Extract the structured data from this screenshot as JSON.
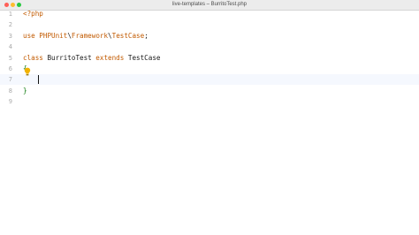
{
  "window": {
    "title": "live-templates – BurritoTest.php"
  },
  "gutter": {
    "line_numbers": [
      "1",
      "2",
      "3",
      "4",
      "5",
      "6",
      "7",
      "8",
      "9"
    ]
  },
  "code": {
    "line1_open_tag": "<?php",
    "line3_use": "use ",
    "line3_ns1": "PHPUnit",
    "line3_sep1": "\\",
    "line3_ns2": "Framework",
    "line3_sep2": "\\",
    "line3_cls": "TestCase",
    "line3_semi": ";",
    "line5_class": "class ",
    "line5_name": "BurritoTest",
    "line5_extends": " extends ",
    "line5_parent": "TestCase",
    "line6_open_brace": "{",
    "line8_close_brace": "}"
  },
  "icons": {
    "intention_bulb": "lightbulb-icon",
    "close": "close-window-icon",
    "minimize": "minimize-window-icon",
    "maximize": "maximize-window-icon"
  },
  "colors": {
    "keyword": "#c25a00",
    "brace": "#0e7a0e",
    "current_line": "#f5f8fe",
    "gutter_text": "#aaaaaa"
  }
}
